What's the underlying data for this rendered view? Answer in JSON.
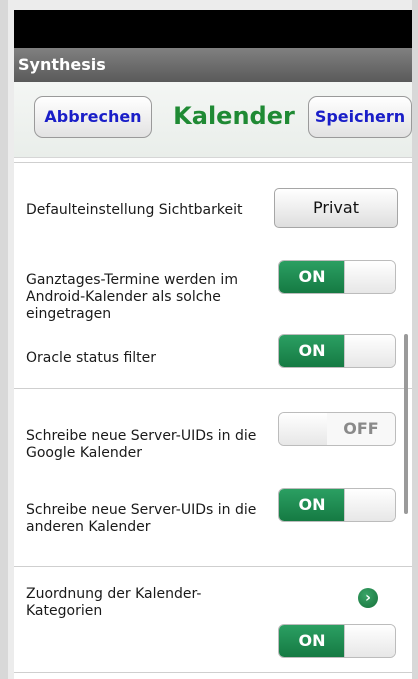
{
  "app": {
    "title": "Synthesis"
  },
  "header": {
    "cancel_label": "Abbrechen",
    "title": "Kalender",
    "save_label": "Speichern"
  },
  "settings": {
    "visibility": {
      "label": "Defaulteinstellung Sichtbarkeit",
      "value": "Privat"
    },
    "allday": {
      "label": "Ganztages-Termine werden im Android-Kalender als solche eingetragen",
      "state": "ON"
    },
    "oracle": {
      "label": "Oracle status filter",
      "state": "ON"
    },
    "google_uids": {
      "label": "Schreibe neue Server-UIDs in die Google Kalender",
      "state": "OFF"
    },
    "other_uids": {
      "label": "Schreibe neue Server-UIDs in die anderen Kalender",
      "state": "ON"
    },
    "categories": {
      "label": "Zuordnung der Kalender-Kategorien",
      "state": "ON"
    }
  },
  "colors": {
    "accent_green": "#1f8a34",
    "toggle_green": "#1e8b50",
    "button_text_blue": "#1a1ec8"
  },
  "icons": {
    "chevron": "chevron-right-icon"
  }
}
